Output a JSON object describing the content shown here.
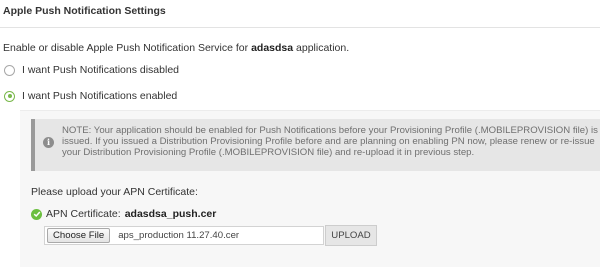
{
  "header": {
    "title": "Apple Push Notification Settings"
  },
  "intro": {
    "prefix": "Enable or disable Apple Push Notification Service for",
    "app_name": "adasdsa",
    "suffix": "application."
  },
  "options": {
    "disabled_label": "I want Push Notifications disabled",
    "enabled_label": "I want Push Notifications enabled",
    "selected": "enabled"
  },
  "note": {
    "text": "NOTE: Your application should be enabled for Push Notifications before your Provisioning Profile (.MOBILEPROVISION file) is issued. If you issued a Distribution Provisioning Profile before and are planning on enabling PN now, please renew or re-issue your Distribution Provisioning Profile (.MOBILEPROVISION file) and re-upload it in previous step."
  },
  "upload": {
    "prompt": "Please upload your APN Certificate:",
    "cert_label": "APN Certificate:",
    "cert_name": "adasdsa_push.cer",
    "choose_label": "Choose File",
    "selected_file": "aps_production 11.27.40.cer",
    "upload_label": "UPLOAD"
  },
  "colors": {
    "accent_green": "#6bbf3f",
    "note_bg": "#e6e6e6",
    "note_border": "#9a9a9a"
  },
  "icons": {
    "info": "info-icon",
    "check": "check-circle-icon"
  }
}
